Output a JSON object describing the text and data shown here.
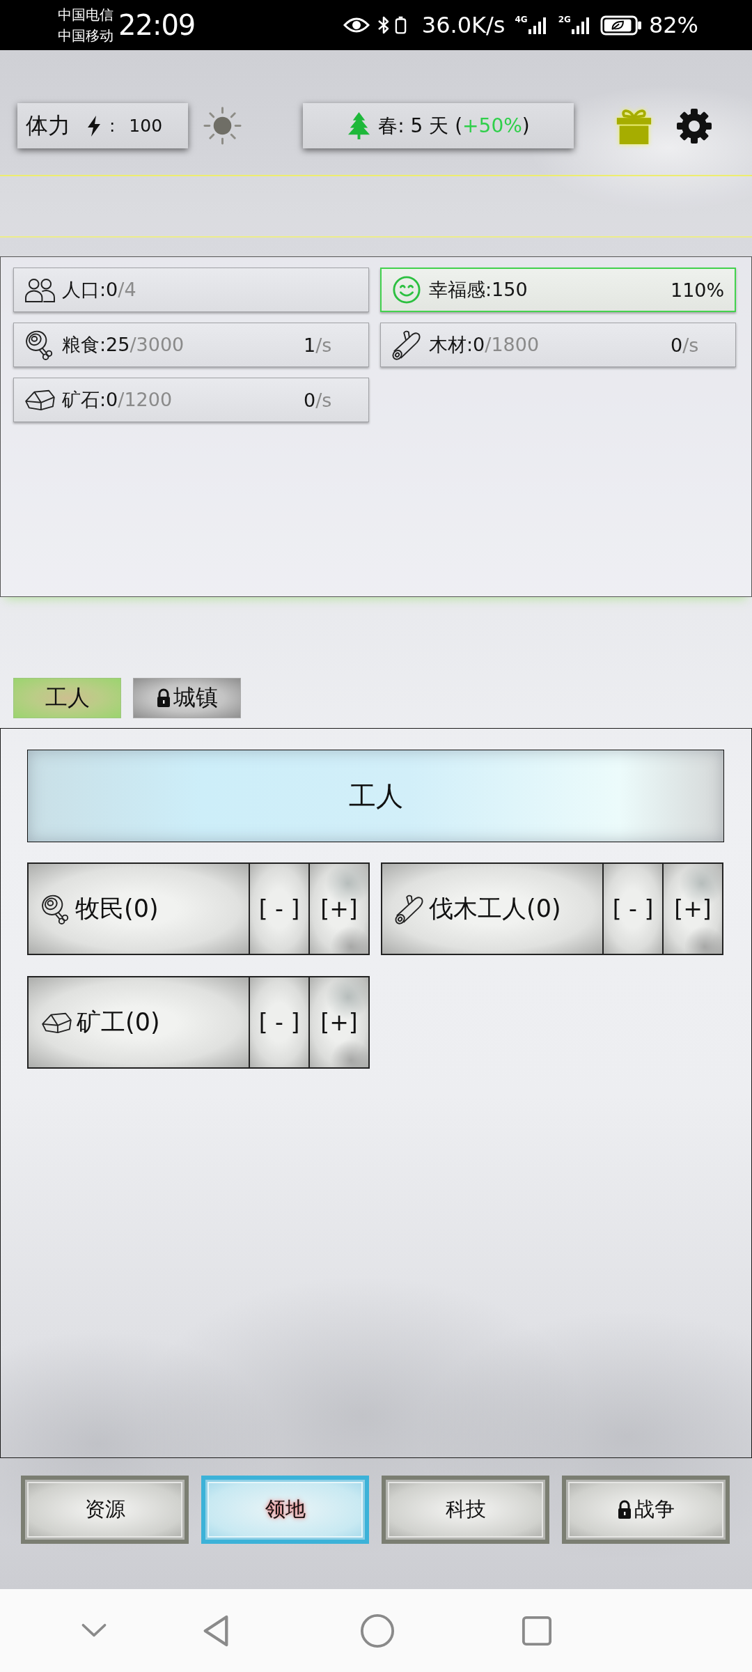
{
  "status_bar": {
    "carriers": [
      "中国电信",
      "中国移动"
    ],
    "time": "22:09",
    "net_speed": "36.0K/s",
    "networks": [
      "4G",
      "2G"
    ],
    "battery": "82%"
  },
  "top_bar": {
    "stamina": {
      "label": "体力",
      "value": ": 100"
    },
    "season": {
      "text": "春: 5 天 (",
      "bonus": "+50%",
      "suffix": ")"
    }
  },
  "resources": [
    {
      "kind": "population",
      "text": "人口:0",
      "capacity": "/4",
      "highlighted": false
    },
    {
      "kind": "happiness",
      "text": "幸福感:150",
      "rate": "110%",
      "highlighted": true
    },
    {
      "kind": "food",
      "text": "粮食:25",
      "capacity": "/3000",
      "rate": "1",
      "rate_unit": "/s",
      "highlighted": false
    },
    {
      "kind": "wood",
      "text": "木材:0",
      "capacity": "/1800",
      "rate": "0",
      "rate_unit": "/s",
      "highlighted": false
    },
    {
      "kind": "ore",
      "text": "矿石:0",
      "capacity": "/1200",
      "rate": "0",
      "rate_unit": "/s",
      "highlighted": false
    }
  ],
  "tabs": [
    {
      "label": "工人",
      "selected": true,
      "locked": false
    },
    {
      "label": "城镇",
      "selected": false,
      "locked": true
    }
  ],
  "workers_panel": {
    "title": "工人",
    "workers": [
      {
        "kind": "food",
        "name": "牧民(0)",
        "decrease": "[ - ]",
        "increase": "[+]"
      },
      {
        "kind": "wood",
        "name": "伐木工人(0)",
        "decrease": "[ - ]",
        "increase": "[+]"
      },
      {
        "kind": "ore",
        "name": "矿工(0)",
        "decrease": "[ - ]",
        "increase": "[+]"
      }
    ]
  },
  "bottom_nav": [
    {
      "label": "资源",
      "selected": false,
      "locked": false
    },
    {
      "label": "领地",
      "selected": true,
      "locked": false
    },
    {
      "label": "科技",
      "selected": false,
      "locked": false
    },
    {
      "label": "战争",
      "selected": false,
      "locked": true
    }
  ]
}
